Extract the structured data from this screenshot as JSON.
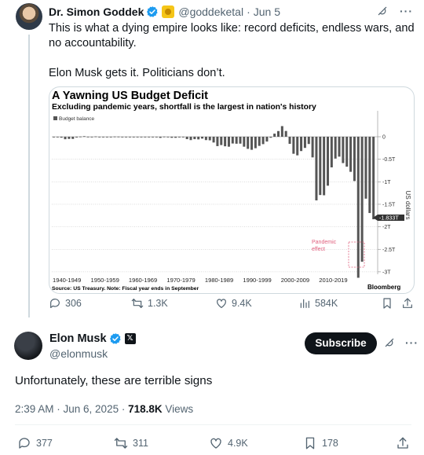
{
  "parent_tweet": {
    "author_name": "Dr. Simon Goddek",
    "handle": "@goddeketal",
    "date": "Jun 5",
    "text_line1": "This is what a dying empire looks like: record deficits, endless wars, and no accountability.",
    "text_line2": "Elon Musk gets it. Politicians don’t.",
    "stats": {
      "replies": "306",
      "reposts": "1.3K",
      "likes": "9.4K",
      "views": "584K"
    }
  },
  "chart_data": {
    "type": "bar",
    "title": "A Yawning US Budget Deficit",
    "subtitle": "Excluding pandemic years, shortfall is the largest in nation's history",
    "legend": "Budget balance",
    "ylabel": "US dollars",
    "y_ticks": [
      "0",
      "-0.5T",
      "-1T",
      "-1.5T",
      "-2T",
      "-2.5T",
      "-3T"
    ],
    "ylim": [
      -3.0,
      0.25
    ],
    "x_labels": [
      "1940-1949",
      "1950-1959",
      "1960-1969",
      "1970-1979",
      "1980-1989",
      "1990-1999",
      "2000-2009",
      "2010-2019"
    ],
    "last_value_label": "-1.833T",
    "annotation": "Pandemic effect",
    "source": "Source: US Treasury. Note: Fiscal year ends in September",
    "brand": "Bloomberg",
    "start_year": 1940,
    "values_trillions": [
      -0.004,
      -0.005,
      -0.02,
      -0.055,
      -0.048,
      -0.048,
      -0.016,
      0.004,
      0.012,
      0.001,
      -0.003,
      0.006,
      -0.002,
      -0.007,
      -0.001,
      -0.003,
      0.004,
      0.003,
      -0.003,
      -0.013,
      0.0,
      -0.003,
      -0.007,
      -0.005,
      -0.006,
      -0.001,
      -0.004,
      -0.009,
      -0.025,
      0.003,
      -0.003,
      -0.023,
      -0.023,
      -0.015,
      -0.006,
      -0.053,
      -0.074,
      -0.054,
      -0.059,
      -0.041,
      -0.074,
      -0.079,
      -0.128,
      -0.208,
      -0.185,
      -0.212,
      -0.221,
      -0.15,
      -0.155,
      -0.153,
      -0.221,
      -0.269,
      -0.29,
      -0.255,
      -0.203,
      -0.164,
      -0.107,
      -0.022,
      0.069,
      0.126,
      0.236,
      0.128,
      -0.158,
      -0.378,
      -0.413,
      -0.318,
      -0.248,
      -0.161,
      -0.459,
      -1.413,
      -1.294,
      -1.3,
      -1.087,
      -0.68,
      -0.485,
      -0.442,
      -0.585,
      -0.665,
      -0.779,
      -0.984,
      -3.132,
      -2.775,
      -1.375,
      -1.694,
      -1.833
    ]
  },
  "reply_tweet": {
    "author_name": "Elon Musk",
    "x_badge": "𝕏",
    "handle": "@elonmusk",
    "subscribe_label": "Subscribe",
    "text": "Unfortunately, these are terrible signs",
    "timestamp": "2:39 AM · Jun 6, 2025 · ",
    "views_count": "718.8K",
    "views_label": " Views",
    "stats": {
      "replies": "377",
      "reposts": "311",
      "likes": "4.9K",
      "bookmarks": "178"
    }
  },
  "colors": {
    "verified": "#1d9bf0",
    "bar": "#555555",
    "annotation": "#e0607e"
  }
}
